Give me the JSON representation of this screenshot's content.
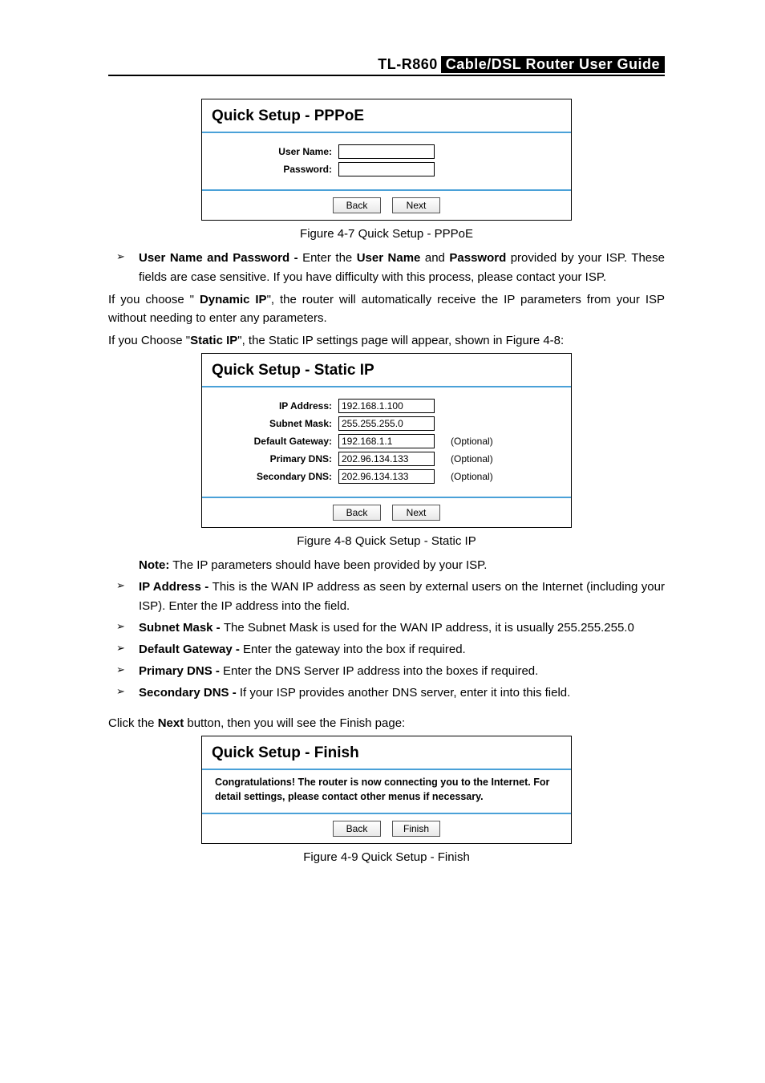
{
  "header": {
    "model": "TL-R860",
    "title": "Cable/DSL Router User Guide"
  },
  "fig47": {
    "heading": "Quick Setup - PPPoE",
    "labels": {
      "user": "User Name:",
      "pass": "Password:"
    },
    "values": {
      "user": "",
      "pass": ""
    },
    "buttons": {
      "back": "Back",
      "next": "Next"
    },
    "caption": "Figure 4-7 Quick Setup - PPPoE"
  },
  "bullet_userpass": {
    "lead": "User Name and Password - ",
    "rest_a": "Enter the ",
    "b_user": "User Name",
    "mid": " and ",
    "b_pass": "Password",
    "rest_b": " provided by your ISP. These fields are case sensitive. If you have difficulty with this process, please contact your ISP."
  },
  "para_dyn": {
    "a": "If you choose \" ",
    "b": "Dynamic IP",
    "c": "\", the router will automatically receive the IP parameters from your ISP without needing to enter any parameters."
  },
  "para_static": {
    "a": "If you Choose \"",
    "b": "Static IP",
    "c": "\", the Static IP settings page will appear, shown in Figure 4-8:"
  },
  "fig48": {
    "heading": "Quick Setup - Static IP",
    "labels": {
      "ip": "IP Address:",
      "mask": "Subnet Mask:",
      "gw": "Default Gateway:",
      "pdns": "Primary DNS:",
      "sdns": "Secondary DNS:"
    },
    "values": {
      "ip": "192.168.1.100",
      "mask": "255.255.255.0",
      "gw": "192.168.1.1",
      "pdns": "202.96.134.133",
      "sdns": "202.96.134.133"
    },
    "optional": "(Optional)",
    "buttons": {
      "back": "Back",
      "next": "Next"
    },
    "caption": "Figure 4-8 Quick Setup - Static IP"
  },
  "note": {
    "lead": "Note:",
    "rest": " The IP parameters should have been provided by your ISP."
  },
  "bullets_static": [
    {
      "lead": "IP Address - ",
      "rest": "This is the WAN IP address as seen by external users on the Internet (including your ISP). Enter the IP address into the field."
    },
    {
      "lead": "Subnet Mask - ",
      "rest": "The Subnet Mask is used for the WAN IP address, it is usually 255.255.255.0"
    },
    {
      "lead": "Default Gateway - ",
      "rest": "Enter the gateway into the box if required."
    },
    {
      "lead": "Primary DNS - ",
      "rest": "Enter the DNS Server IP address into the boxes if required."
    },
    {
      "lead": "Secondary DNS - ",
      "rest": "If your ISP provides another DNS server, enter it into this field."
    }
  ],
  "para_next": {
    "a": "Click the ",
    "b": "Next",
    "c": " button, then you will see the Finish page:"
  },
  "fig49": {
    "heading": "Quick Setup - Finish",
    "msg": "Congratulations! The router is now connecting you to the Internet. For detail settings, please contact other menus if necessary.",
    "buttons": {
      "back": "Back",
      "finish": "Finish"
    },
    "caption": "Figure 4-9 Quick Setup - Finish"
  }
}
